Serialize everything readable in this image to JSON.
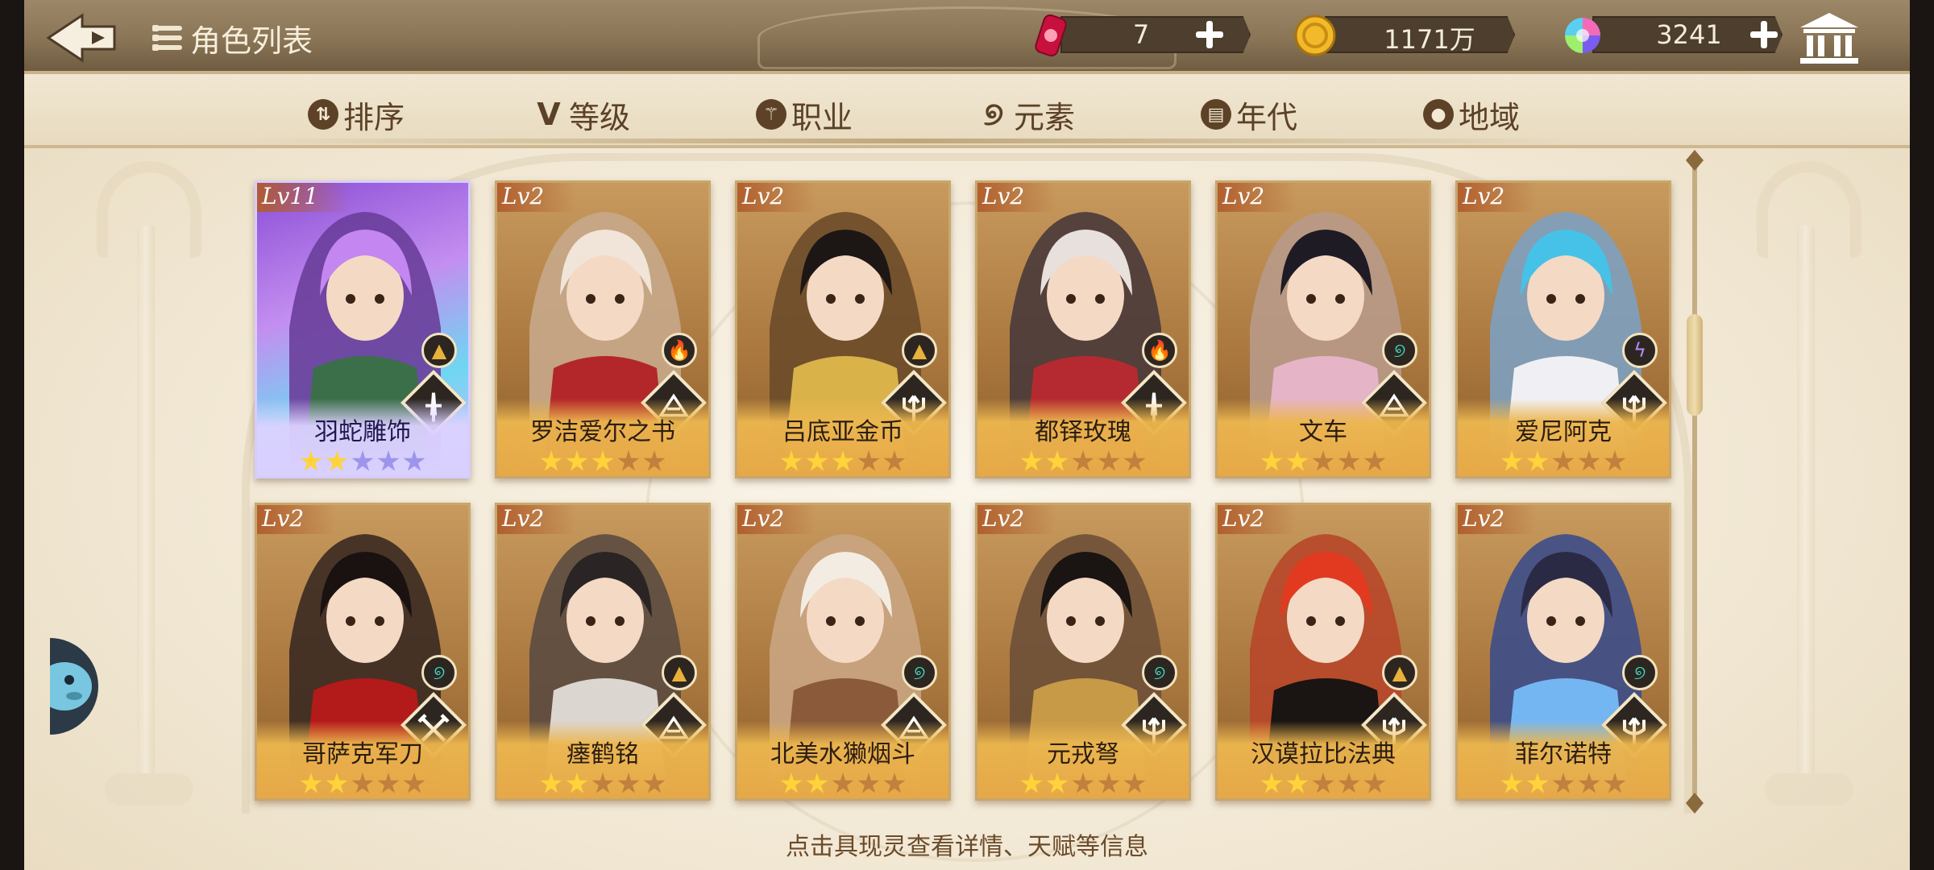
{
  "header": {
    "title": "角色列表",
    "currencies": [
      {
        "icon": "ticket-icon",
        "value": "7"
      },
      {
        "icon": "gold-coin-icon",
        "value": "1171万"
      },
      {
        "icon": "crystal-icon",
        "value": "3241"
      }
    ]
  },
  "tabs": [
    {
      "label": "排序",
      "icon": "sort-icon"
    },
    {
      "label": "等级",
      "icon": "level-icon"
    },
    {
      "label": "职业",
      "icon": "class-icon"
    },
    {
      "label": "元素",
      "icon": "element-icon"
    },
    {
      "label": "年代",
      "icon": "era-icon"
    },
    {
      "label": "地域",
      "icon": "location-icon"
    }
  ],
  "characters": [
    {
      "level": "Lv11",
      "name": "羽蛇雕饰",
      "stars": 2,
      "element": "earth",
      "class": "sword",
      "special": true
    },
    {
      "level": "Lv2",
      "name": "罗洁爱尔之书",
      "stars": 3,
      "element": "fire",
      "class": "book"
    },
    {
      "level": "Lv2",
      "name": "吕底亚金币",
      "stars": 3,
      "element": "earth",
      "class": "trident"
    },
    {
      "level": "Lv2",
      "name": "都铎玫瑰",
      "stars": 2,
      "element": "fire",
      "class": "sword"
    },
    {
      "level": "Lv2",
      "name": "文车",
      "stars": 2,
      "element": "wind",
      "class": "book"
    },
    {
      "level": "Lv2",
      "name": "爱尼阿克",
      "stars": 2,
      "element": "thunder",
      "class": "trident"
    },
    {
      "level": "Lv2",
      "name": "哥萨克军刀",
      "stars": 2,
      "element": "wind",
      "class": "cross"
    },
    {
      "level": "Lv2",
      "name": "瘗鹤铭",
      "stars": 2,
      "element": "earth",
      "class": "book"
    },
    {
      "level": "Lv2",
      "name": "北美水獭烟斗",
      "stars": 2,
      "element": "wind",
      "class": "book"
    },
    {
      "level": "Lv2",
      "name": "元戎弩",
      "stars": 2,
      "element": "wind",
      "class": "trident"
    },
    {
      "level": "Lv2",
      "name": "汉谟拉比法典",
      "stars": 2,
      "element": "earth",
      "class": "trident"
    },
    {
      "level": "Lv2",
      "name": "菲尔诺特",
      "stars": 2,
      "element": "wind",
      "class": "trident"
    }
  ],
  "hint": "点击具现灵查看详情、天赋等信息"
}
